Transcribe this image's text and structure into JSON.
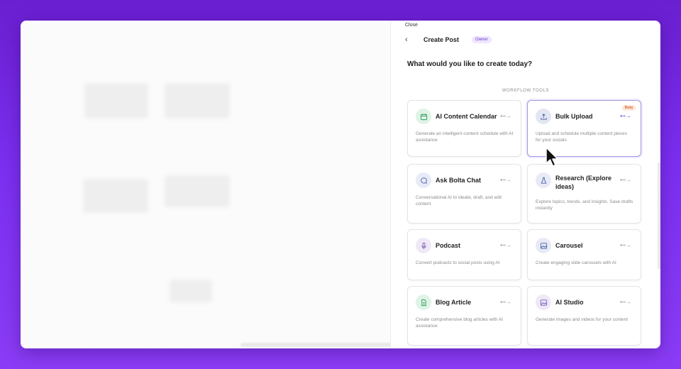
{
  "panel": {
    "close_label": "Close",
    "title": "Create Post",
    "role_badge": "Owner",
    "question": "What would you like to create today?",
    "section_label": "WORKFLOW TOOLS"
  },
  "cards": [
    {
      "name": "AI Content Calendar",
      "desc": "Generate an intelligent content schedule with AI assistance",
      "icon": "calendar-icon"
    },
    {
      "name": "Bulk Upload",
      "desc": "Upload and schedule multiple content pieces for your socials",
      "icon": "upload-icon",
      "badge": "Beta"
    },
    {
      "name": "Ask Bolta Chat",
      "desc": "Conversational AI to ideate, draft, and edit content",
      "icon": "chat-bubble-icon"
    },
    {
      "name": "Research (Explore ideas)",
      "desc": "Explore topics, trends, and insights. Save drafts instantly",
      "icon": "flask-icon"
    },
    {
      "name": "Podcast",
      "desc": "Convert podcasts to social posts using AI",
      "icon": "microphone-icon"
    },
    {
      "name": "Carousel",
      "desc": "Create engaging slide carousels with AI",
      "icon": "image-icon"
    },
    {
      "name": "Blog Article",
      "desc": "Create comprehensive blog articles with AI assistance",
      "icon": "document-icon"
    },
    {
      "name": "AI Studio",
      "desc": "Generate images and videos for your content",
      "icon": "image-icon"
    }
  ],
  "colors": {
    "accent": "#7b2ff0",
    "calendar_bg": "#dff3e6",
    "upload_bg": "#e3e7f3",
    "chat_bg": "#e8ebf6",
    "flask_bg": "#e8ebf6",
    "mic_bg": "#efe8f7",
    "image_bg": "#e8ebf6",
    "doc_bg": "#dff3e6"
  }
}
